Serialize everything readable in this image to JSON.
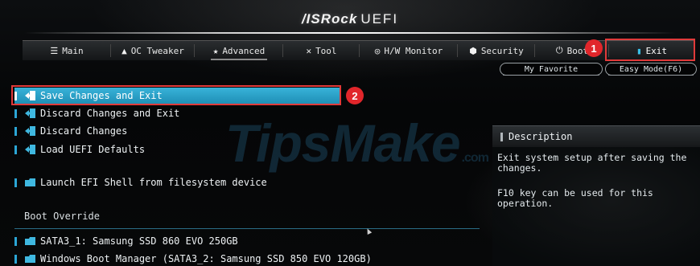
{
  "header": {
    "brand": "/ISRock",
    "product": "UEFI"
  },
  "tabs": [
    {
      "id": "main",
      "label": "Main",
      "icon": "list-icon"
    },
    {
      "id": "oc",
      "label": "OC Tweaker",
      "icon": "rocket-icon"
    },
    {
      "id": "advanced",
      "label": "Advanced",
      "icon": "star-icon"
    },
    {
      "id": "tool",
      "label": "Tool",
      "icon": "wrench-icon"
    },
    {
      "id": "hw",
      "label": "H/W Monitor",
      "icon": "monitor-icon"
    },
    {
      "id": "security",
      "label": "Security",
      "icon": "shield-icon"
    },
    {
      "id": "boot",
      "label": "Boot",
      "icon": "power-icon"
    },
    {
      "id": "exit",
      "label": "Exit",
      "icon": "exit-door-icon",
      "active": true
    }
  ],
  "buttons": {
    "favorite": "My Favorite",
    "easy_mode": "Easy Mode(F6)"
  },
  "annotations": {
    "one": "1",
    "two": "2"
  },
  "menu": {
    "save_exit": "Save Changes and Exit",
    "discard_exit": "Discard Changes and Exit",
    "discard": "Discard Changes",
    "load_defaults": "Load UEFI Defaults",
    "efi_shell": "Launch EFI Shell from filesystem device",
    "boot_override_label": "Boot Override",
    "boot_1": "SATA3_1: Samsung SSD 860 EVO 250GB",
    "boot_2": "Windows Boot Manager (SATA3_2: Samsung SSD 850 EVO 120GB)"
  },
  "description": {
    "title": "Description",
    "line1": "Exit system setup after saving the changes.",
    "line2": "F10 key can be used for this operation."
  },
  "watermark": {
    "main": "TipsMake",
    "suffix": ".com"
  },
  "colors": {
    "accent": "#2ba6d6",
    "annotation": "#e03a3a",
    "background": "#050607"
  }
}
